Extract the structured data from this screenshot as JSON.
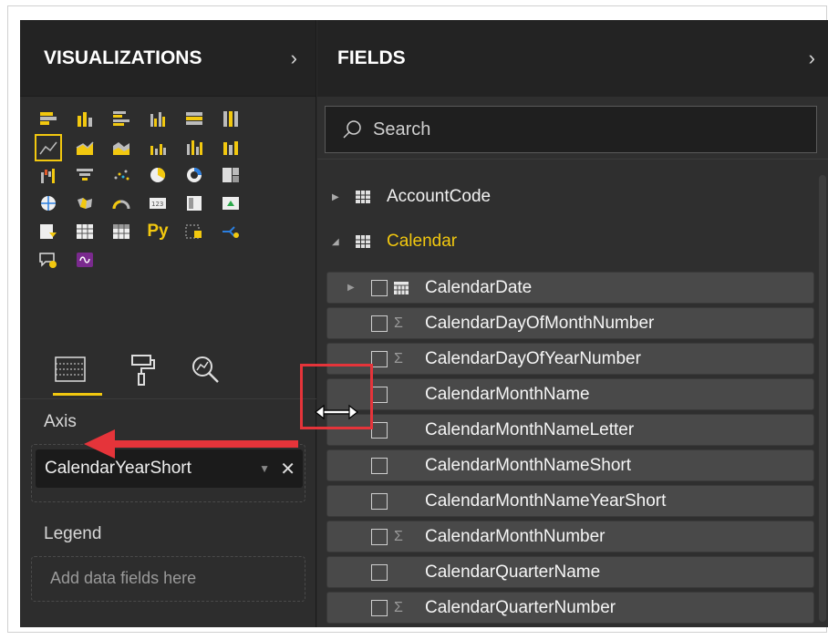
{
  "visualizations": {
    "title": "VISUALIZATIONS",
    "collapse_icon": "chevron-right-icon"
  },
  "viz_icons": [
    "stacked-bar-icon",
    "stacked-column-icon",
    "clustered-bar-icon",
    "clustered-column-icon",
    "100-stacked-bar-icon",
    "100-stacked-column-icon",
    "line-chart-icon",
    "area-chart-icon",
    "stacked-area-icon",
    "line-clustered-column-icon",
    "line-stacked-column-icon",
    "ribbon-chart-icon",
    "waterfall-icon",
    "funnel-icon",
    "scatter-icon",
    "pie-icon",
    "donut-icon",
    "treemap-icon",
    "map-icon",
    "filled-map-icon",
    "gauge-icon",
    "card-icon",
    "multi-row-card-icon",
    "kpi-icon",
    "slicer-icon",
    "table-icon",
    "matrix-icon",
    "python-visual-icon",
    "key-influencers-icon",
    "decomposition-tree-icon",
    "qa-icon",
    "custom-visual-icon"
  ],
  "python_label": "Py",
  "tabs": [
    "fields-tab-icon",
    "format-tab-icon",
    "analytics-tab-icon"
  ],
  "axis_label": "Axis",
  "axis_field": {
    "value": "CalendarYearShort"
  },
  "legend_label": "Legend",
  "legend_placeholder": "Add data fields here",
  "fields": {
    "title": "FIELDS",
    "collapse_icon": "chevron-right-icon"
  },
  "search": {
    "placeholder": "Search"
  },
  "tables": [
    {
      "name": "AccountCode",
      "expanded": false
    },
    {
      "name": "Calendar",
      "expanded": true
    }
  ],
  "calendar_fields": [
    {
      "name": "CalendarDate",
      "sigma": false,
      "date": true,
      "expandable": true
    },
    {
      "name": "CalendarDayOfMonthNumber",
      "sigma": true
    },
    {
      "name": "CalendarDayOfYearNumber",
      "sigma": true
    },
    {
      "name": "CalendarMonthName",
      "sigma": false
    },
    {
      "name": "CalendarMonthNameLetter",
      "sigma": false
    },
    {
      "name": "CalendarMonthNameShort",
      "sigma": false
    },
    {
      "name": "CalendarMonthNameYearShort",
      "sigma": false
    },
    {
      "name": "CalendarMonthNumber",
      "sigma": true
    },
    {
      "name": "CalendarQuarterName",
      "sigma": false
    },
    {
      "name": "CalendarQuarterNumber",
      "sigma": true
    }
  ],
  "colors": {
    "accent": "#f2c80f",
    "annotation": "#e5343a"
  }
}
